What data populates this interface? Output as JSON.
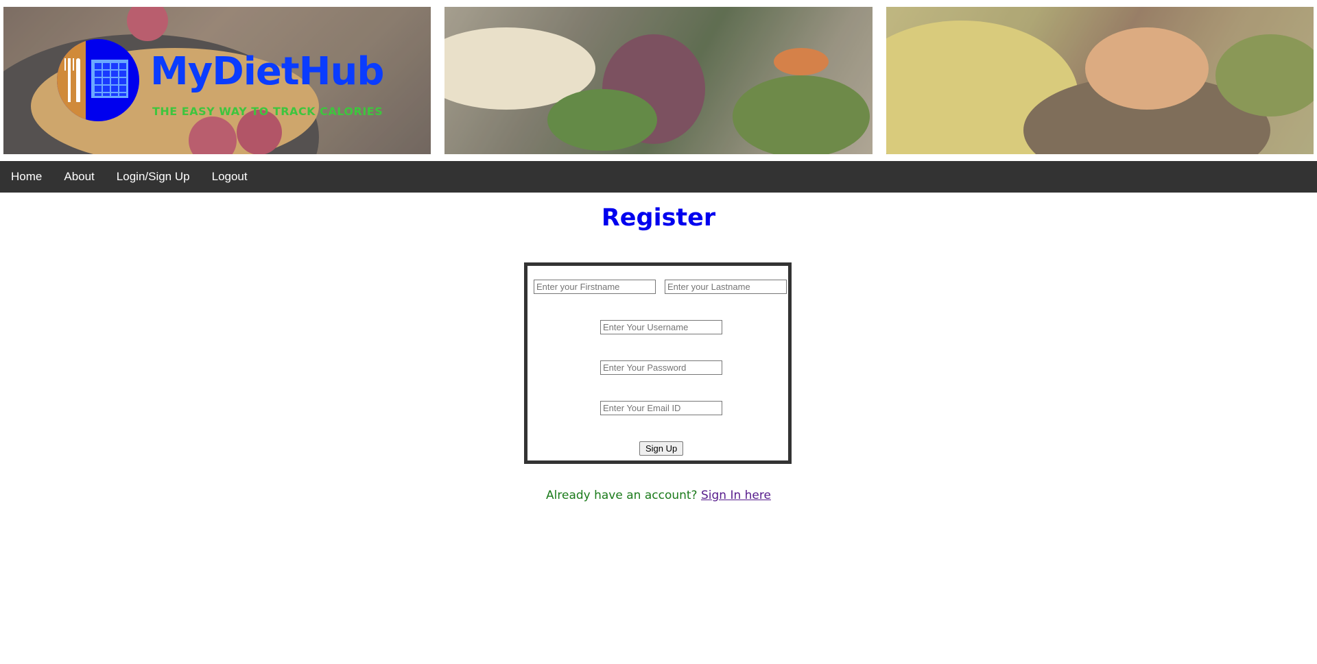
{
  "header": {
    "logo_title": "MyDietHub",
    "logo_tagline": "THE EASY WAY TO TRACK CALORIES",
    "banners": [
      "pancakes-with-raspberries-image",
      "fig-salad-image",
      "salmon-shrimp-dish-image"
    ]
  },
  "nav": {
    "items": [
      {
        "label": "Home"
      },
      {
        "label": "About"
      },
      {
        "label": "Login/Sign Up"
      },
      {
        "label": "Logout"
      }
    ]
  },
  "page": {
    "title": "Register"
  },
  "form": {
    "firstname_placeholder": "Enter your Firstname",
    "lastname_placeholder": "Enter your Lastname",
    "username_placeholder": "Enter Your Username",
    "password_placeholder": "Enter Your Password",
    "email_placeholder": "Enter Your Email ID",
    "submit_label": "Sign Up"
  },
  "footer": {
    "prompt": "Already have an account?",
    "link_label": "Sign In here"
  },
  "colors": {
    "title": "#0000ee",
    "nav_bg": "#333333",
    "prompt_text": "#1a7a1a",
    "visited_link": "#551a8b"
  }
}
